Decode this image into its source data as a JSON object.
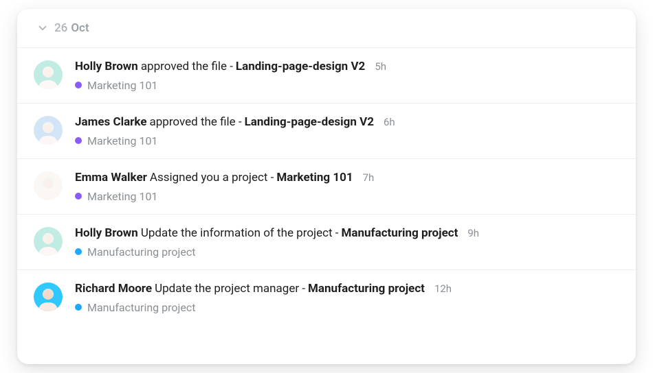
{
  "header": {
    "day": "26",
    "month": "Oct"
  },
  "colors": {
    "purple": "#8a5cf6",
    "blue": "#1fa8ff"
  },
  "avatars": {
    "holly": "teal",
    "james": "blue",
    "emma": "white",
    "richard": "cyan"
  },
  "items": [
    {
      "actor": "Holly Brown",
      "action": "approved the file -",
      "object": "Landing-page-design V2",
      "time": "5h",
      "tag": {
        "label": "Marketing 101",
        "color": "purple"
      },
      "avatar": "holly",
      "faded": true
    },
    {
      "actor": "James Clarke",
      "action": "approved the file -",
      "object": "Landing-page-design V2",
      "time": "6h",
      "tag": {
        "label": "Marketing 101",
        "color": "purple"
      },
      "avatar": "james",
      "faded": true
    },
    {
      "actor": "Emma Walker",
      "action": "Assigned you a project -",
      "object": "Marketing 101",
      "time": "7h",
      "tag": {
        "label": "Marketing 101",
        "color": "purple"
      },
      "avatar": "emma",
      "faded": true
    },
    {
      "actor": "Holly Brown",
      "action": "Update the information of the project -",
      "object": "Manufacturing project",
      "time": "9h",
      "tag": {
        "label": "Manufacturing project",
        "color": "blue"
      },
      "avatar": "holly",
      "faded": true
    },
    {
      "actor": "Richard Moore",
      "action": "Update the project manager -",
      "object": "Manufacturing project",
      "time": "12h",
      "tag": {
        "label": "Manufacturing project",
        "color": "blue"
      },
      "avatar": "richard",
      "faded": false
    }
  ]
}
